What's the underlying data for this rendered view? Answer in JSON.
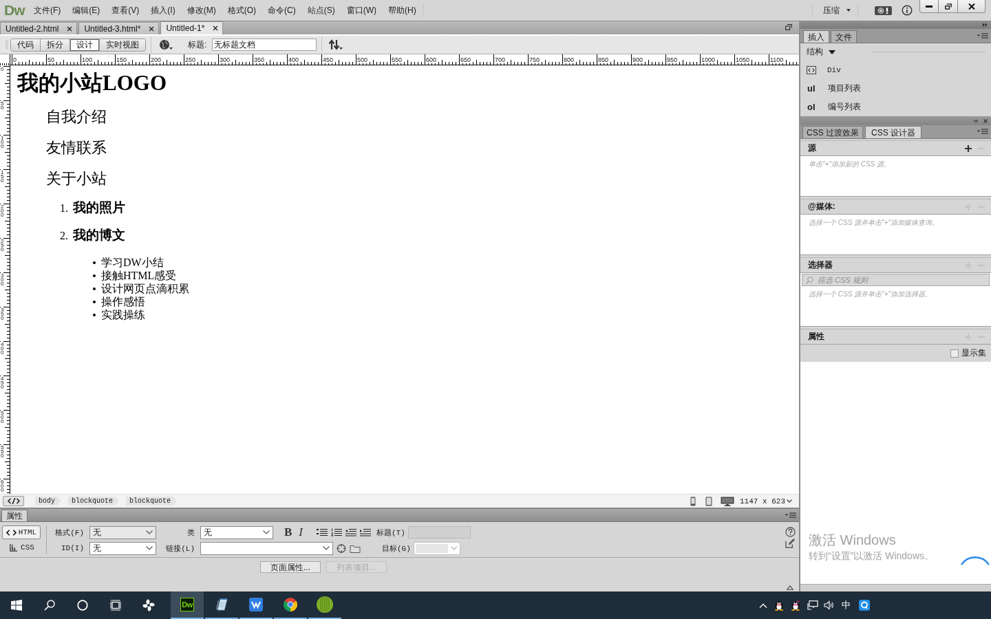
{
  "menu_bar": {
    "logo": "Dw",
    "menus": [
      "文件(F)",
      "编辑(E)",
      "查看(V)",
      "插入(I)",
      "修改(M)",
      "格式(O)",
      "命令(C)",
      "站点(S)",
      "窗口(W)",
      "帮助(H)"
    ],
    "workspace": "压缩"
  },
  "document_tabs": [
    {
      "label": "Untitled-2.html",
      "selected": false
    },
    {
      "label": "Untitled-3.html*",
      "selected": false
    },
    {
      "label": "Untitled-1*",
      "selected": true
    }
  ],
  "document_toolbar": {
    "views": [
      {
        "label": "代码",
        "selected": false
      },
      {
        "label": "拆分",
        "selected": false
      },
      {
        "label": "设计",
        "selected": true
      },
      {
        "label": "实时视图",
        "selected": false
      }
    ],
    "title_label": "标题:",
    "title_value": "无标题文档"
  },
  "rulers": {
    "horizontal": [
      "0",
      "50",
      "100",
      "150",
      "200",
      "250",
      "300",
      "350",
      "400",
      "450",
      "500",
      "550",
      "600",
      "650",
      "700",
      "750",
      "800",
      "850",
      "900",
      "950",
      "1000",
      "1050",
      "1100"
    ],
    "vertical": [
      "0",
      "50",
      "100",
      "150",
      "200",
      "250",
      "300",
      "350",
      "400",
      "450",
      "500",
      "550",
      "600"
    ]
  },
  "page": {
    "logo_heading": "我的小站LOGO",
    "nav_items": [
      "自我介绍",
      "友情联系",
      "关于小站"
    ],
    "numbered_items": [
      {
        "number": "1.",
        "text": "我的照片"
      },
      {
        "number": "2.",
        "text": "我的博文"
      }
    ],
    "bullet_items": [
      "学习DW小结",
      "接触HTML感受",
      "设计网页点滴积累",
      "操作感悟",
      "实践操练"
    ]
  },
  "tag_selector": {
    "tags": [
      "body",
      "blockquote",
      "blockquote"
    ],
    "window_size": "1147 x 623"
  },
  "property_inspector": {
    "title": "属性",
    "modes": [
      {
        "kind": "html",
        "label": "HTML",
        "selected": true
      },
      {
        "kind": "css",
        "label": "CSS",
        "selected": false
      }
    ],
    "format": {
      "label": "格式(F)",
      "value": "无"
    },
    "id": {
      "label": "ID(I)",
      "value": "无"
    },
    "class": {
      "label": "类",
      "value": "无"
    },
    "link": {
      "label": "链接(L)"
    },
    "text_styles": [
      {
        "kind": "bold",
        "label": "B"
      },
      {
        "kind": "italic",
        "label": "I"
      }
    ],
    "heading_field": {
      "label": "标题(T)",
      "disabled": true
    },
    "target": {
      "label": "目标(G)",
      "disabled": true
    },
    "buttons": [
      {
        "label": "页面属性...",
        "disabled": false
      },
      {
        "label": "列表项目...",
        "disabled": true
      }
    ]
  },
  "insert_panel": {
    "tabs": [
      {
        "label": "插入",
        "selected": true
      },
      {
        "label": "文件",
        "selected": false
      }
    ],
    "category": "结构",
    "items": [
      {
        "kind": "icon",
        "label": "Div"
      },
      {
        "kind": "tag",
        "tag": "ul",
        "label": "项目列表"
      },
      {
        "kind": "tag",
        "tag": "ol",
        "label": "编号列表"
      }
    ]
  },
  "css_panel": {
    "tabs": [
      {
        "label": "CSS 过渡效果",
        "selected": false
      },
      {
        "label": "CSS 设计器",
        "selected": true
      }
    ],
    "sections": [
      {
        "kind": "list",
        "title": "源",
        "add_enabled": true,
        "remove_enabled": false,
        "hint": "单击\"+\"添加新的 CSS 源。"
      },
      {
        "kind": "list",
        "title": "@媒体:",
        "add_enabled": false,
        "remove_enabled": false,
        "hint": "选择一个 CSS 源并单击\"+\"添加媒体查询。"
      },
      {
        "kind": "filter",
        "title": "选择器",
        "add_enabled": false,
        "remove_enabled": false,
        "placeholder": "筛选 CSS 规则",
        "hint": "选择一个 CSS 源并单击\"+\"添加选择器。"
      },
      {
        "kind": "properties",
        "title": "属性",
        "add_enabled": false,
        "remove_enabled": false,
        "show_set": {
          "label": "显示集",
          "checked": false
        }
      }
    ]
  },
  "windows_notice": {
    "title": "激活 Windows",
    "text": "转到“设置”以激活 Windows。"
  },
  "taskbar": {
    "apps": [
      {
        "kind": "pinwheel",
        "running": false,
        "active": false
      },
      {
        "kind": "dw",
        "label": "Dw",
        "running": true,
        "active": true
      },
      {
        "kind": "notepad",
        "running": true,
        "active": false
      },
      {
        "kind": "wps",
        "running": true,
        "active": false
      },
      {
        "kind": "browser",
        "running": true,
        "active": false
      },
      {
        "kind": "green-ball",
        "running": true,
        "active": false
      }
    ],
    "input_method": "中"
  }
}
